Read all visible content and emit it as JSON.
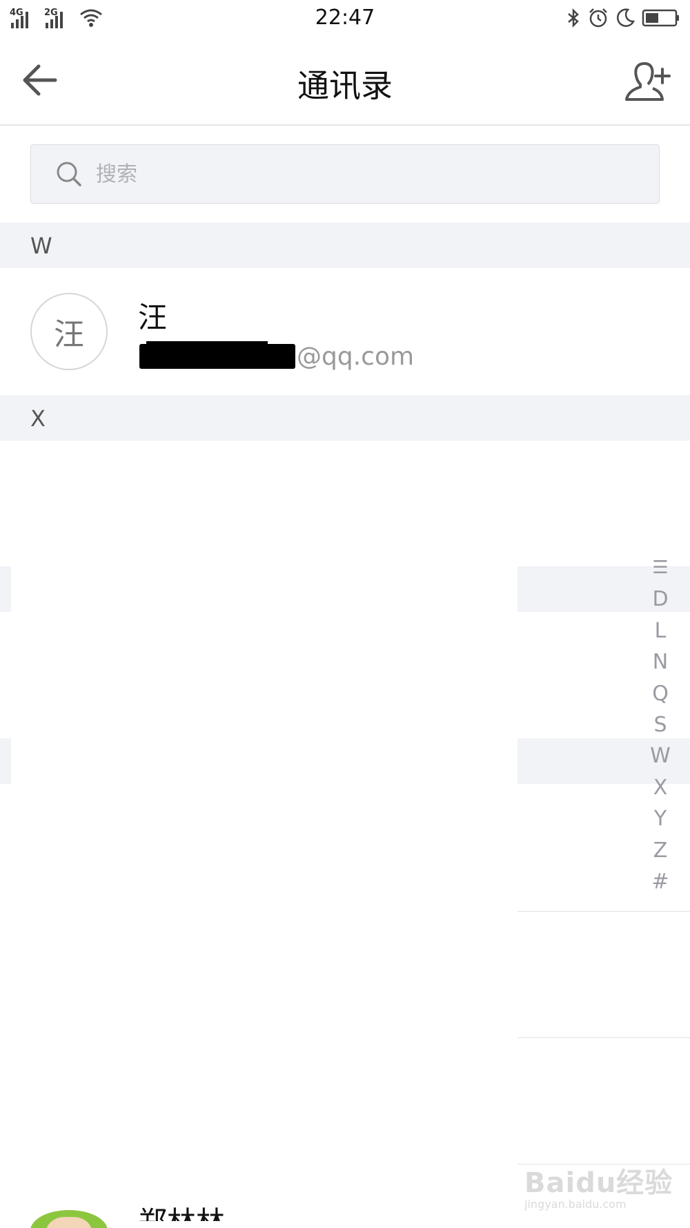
{
  "status_bar": {
    "time": "22:47",
    "network_1": "4G",
    "network_2": "2G"
  },
  "nav": {
    "title": "通讯录"
  },
  "search": {
    "placeholder": "搜索"
  },
  "sections": [
    {
      "letter": "W",
      "contacts": [
        {
          "avatar_char": "汪",
          "name": "汪",
          "email_suffix": "@qq.com"
        }
      ]
    },
    {
      "letter": "X"
    }
  ],
  "alpha_index": [
    "☰",
    "D",
    "L",
    "N",
    "Q",
    "S",
    "W",
    "X",
    "Y",
    "Z",
    "#"
  ],
  "partial_contact": {
    "name": "郑林林"
  },
  "watermark": {
    "main": "Baidu经验",
    "sub": "jingyan.baidu.com"
  }
}
